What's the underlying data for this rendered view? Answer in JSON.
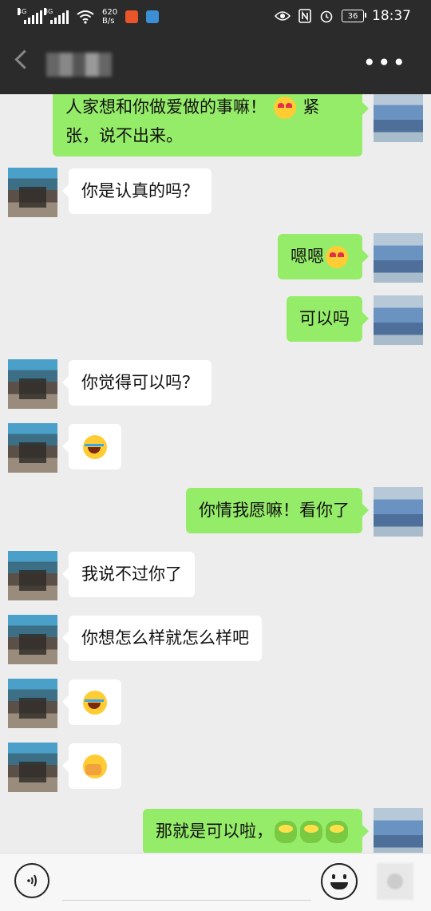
{
  "status_bar": {
    "network_1": "4G",
    "network_2": "3G",
    "speed_value": "620",
    "speed_unit": "B/s",
    "battery": "36",
    "time": "18:37"
  },
  "messages": [
    {
      "side": "me",
      "text": "人家想和你做爱做的事嘛！",
      "emoji": "heart-eyes-emoji",
      "text2": "紧",
      "line2": "张，说不出来。"
    },
    {
      "side": "other",
      "text": "你是认真的吗？"
    },
    {
      "side": "me",
      "text": "嗯嗯",
      "emoji": "heart-eyes-emoji"
    },
    {
      "side": "me",
      "text": "可以吗"
    },
    {
      "side": "other",
      "text": "你觉得可以吗？"
    },
    {
      "side": "other",
      "emoji": "tears-of-joy-emoji"
    },
    {
      "side": "me",
      "text": "你情我愿嘛！看你了"
    },
    {
      "side": "other",
      "text": "我说不过你了"
    },
    {
      "side": "other",
      "text": "你想怎么样就怎么样吧"
    },
    {
      "side": "other",
      "emoji": "tears-of-joy-emoji"
    },
    {
      "side": "other",
      "emoji": "facepalm-emoji"
    },
    {
      "side": "me",
      "text": "那就是可以啦，",
      "emoji": "frog-emoji"
    }
  ]
}
